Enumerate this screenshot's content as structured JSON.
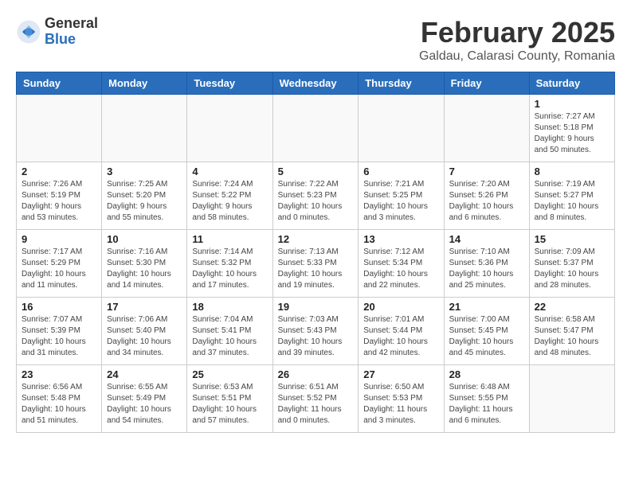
{
  "header": {
    "logo_general": "General",
    "logo_blue": "Blue",
    "month_title": "February 2025",
    "location": "Galdau, Calarasi County, Romania"
  },
  "weekdays": [
    "Sunday",
    "Monday",
    "Tuesday",
    "Wednesday",
    "Thursday",
    "Friday",
    "Saturday"
  ],
  "weeks": [
    [
      {
        "day": "",
        "info": ""
      },
      {
        "day": "",
        "info": ""
      },
      {
        "day": "",
        "info": ""
      },
      {
        "day": "",
        "info": ""
      },
      {
        "day": "",
        "info": ""
      },
      {
        "day": "",
        "info": ""
      },
      {
        "day": "1",
        "info": "Sunrise: 7:27 AM\nSunset: 5:18 PM\nDaylight: 9 hours and 50 minutes."
      }
    ],
    [
      {
        "day": "2",
        "info": "Sunrise: 7:26 AM\nSunset: 5:19 PM\nDaylight: 9 hours and 53 minutes."
      },
      {
        "day": "3",
        "info": "Sunrise: 7:25 AM\nSunset: 5:20 PM\nDaylight: 9 hours and 55 minutes."
      },
      {
        "day": "4",
        "info": "Sunrise: 7:24 AM\nSunset: 5:22 PM\nDaylight: 9 hours and 58 minutes."
      },
      {
        "day": "5",
        "info": "Sunrise: 7:22 AM\nSunset: 5:23 PM\nDaylight: 10 hours and 0 minutes."
      },
      {
        "day": "6",
        "info": "Sunrise: 7:21 AM\nSunset: 5:25 PM\nDaylight: 10 hours and 3 minutes."
      },
      {
        "day": "7",
        "info": "Sunrise: 7:20 AM\nSunset: 5:26 PM\nDaylight: 10 hours and 6 minutes."
      },
      {
        "day": "8",
        "info": "Sunrise: 7:19 AM\nSunset: 5:27 PM\nDaylight: 10 hours and 8 minutes."
      }
    ],
    [
      {
        "day": "9",
        "info": "Sunrise: 7:17 AM\nSunset: 5:29 PM\nDaylight: 10 hours and 11 minutes."
      },
      {
        "day": "10",
        "info": "Sunrise: 7:16 AM\nSunset: 5:30 PM\nDaylight: 10 hours and 14 minutes."
      },
      {
        "day": "11",
        "info": "Sunrise: 7:14 AM\nSunset: 5:32 PM\nDaylight: 10 hours and 17 minutes."
      },
      {
        "day": "12",
        "info": "Sunrise: 7:13 AM\nSunset: 5:33 PM\nDaylight: 10 hours and 19 minutes."
      },
      {
        "day": "13",
        "info": "Sunrise: 7:12 AM\nSunset: 5:34 PM\nDaylight: 10 hours and 22 minutes."
      },
      {
        "day": "14",
        "info": "Sunrise: 7:10 AM\nSunset: 5:36 PM\nDaylight: 10 hours and 25 minutes."
      },
      {
        "day": "15",
        "info": "Sunrise: 7:09 AM\nSunset: 5:37 PM\nDaylight: 10 hours and 28 minutes."
      }
    ],
    [
      {
        "day": "16",
        "info": "Sunrise: 7:07 AM\nSunset: 5:39 PM\nDaylight: 10 hours and 31 minutes."
      },
      {
        "day": "17",
        "info": "Sunrise: 7:06 AM\nSunset: 5:40 PM\nDaylight: 10 hours and 34 minutes."
      },
      {
        "day": "18",
        "info": "Sunrise: 7:04 AM\nSunset: 5:41 PM\nDaylight: 10 hours and 37 minutes."
      },
      {
        "day": "19",
        "info": "Sunrise: 7:03 AM\nSunset: 5:43 PM\nDaylight: 10 hours and 39 minutes."
      },
      {
        "day": "20",
        "info": "Sunrise: 7:01 AM\nSunset: 5:44 PM\nDaylight: 10 hours and 42 minutes."
      },
      {
        "day": "21",
        "info": "Sunrise: 7:00 AM\nSunset: 5:45 PM\nDaylight: 10 hours and 45 minutes."
      },
      {
        "day": "22",
        "info": "Sunrise: 6:58 AM\nSunset: 5:47 PM\nDaylight: 10 hours and 48 minutes."
      }
    ],
    [
      {
        "day": "23",
        "info": "Sunrise: 6:56 AM\nSunset: 5:48 PM\nDaylight: 10 hours and 51 minutes."
      },
      {
        "day": "24",
        "info": "Sunrise: 6:55 AM\nSunset: 5:49 PM\nDaylight: 10 hours and 54 minutes."
      },
      {
        "day": "25",
        "info": "Sunrise: 6:53 AM\nSunset: 5:51 PM\nDaylight: 10 hours and 57 minutes."
      },
      {
        "day": "26",
        "info": "Sunrise: 6:51 AM\nSunset: 5:52 PM\nDaylight: 11 hours and 0 minutes."
      },
      {
        "day": "27",
        "info": "Sunrise: 6:50 AM\nSunset: 5:53 PM\nDaylight: 11 hours and 3 minutes."
      },
      {
        "day": "28",
        "info": "Sunrise: 6:48 AM\nSunset: 5:55 PM\nDaylight: 11 hours and 6 minutes."
      },
      {
        "day": "",
        "info": ""
      }
    ]
  ]
}
